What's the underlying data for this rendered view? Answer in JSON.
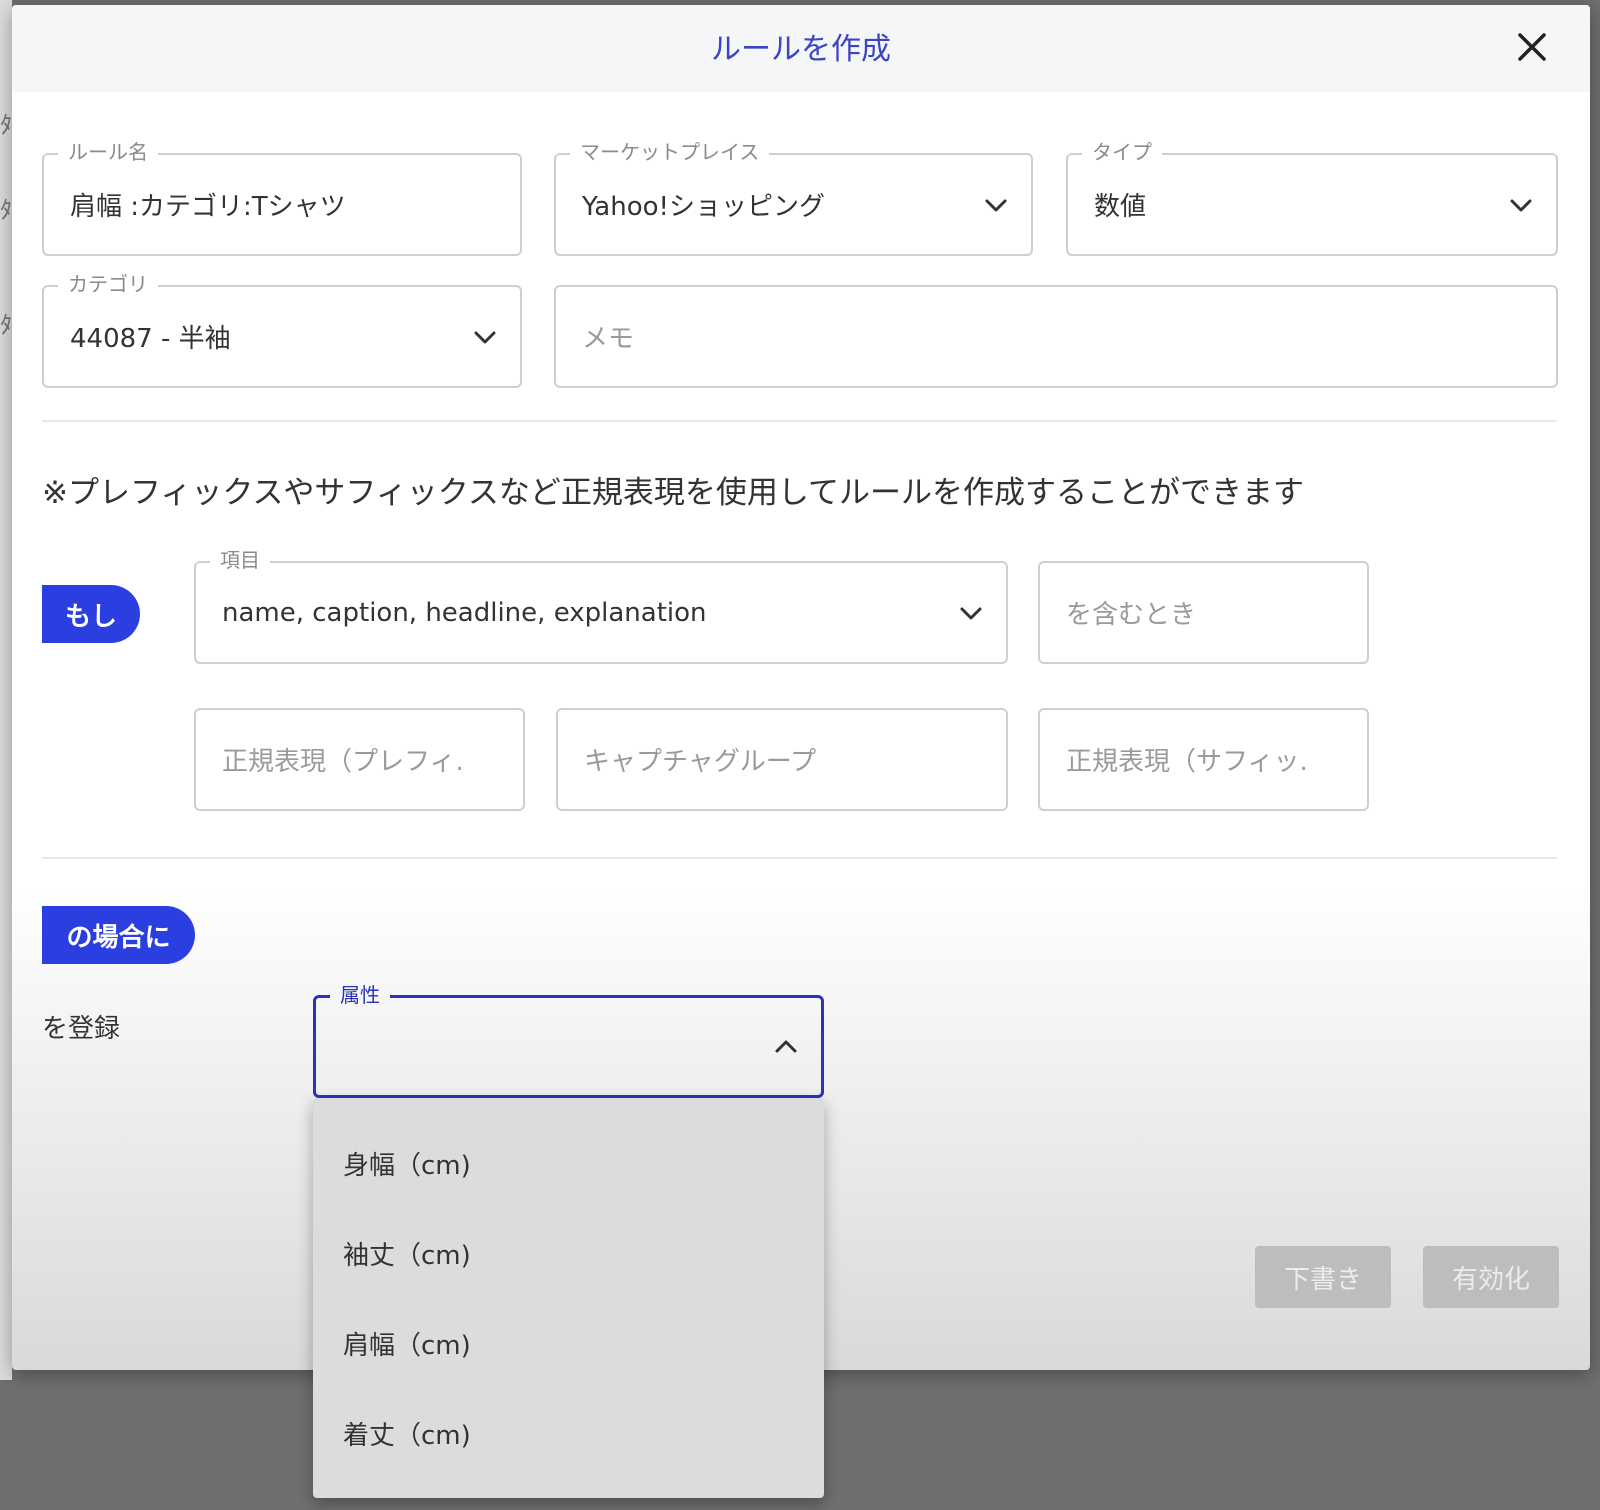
{
  "dialog": {
    "title": "ルールを作成"
  },
  "fields": {
    "rule_name": {
      "label": "ルール名",
      "value": "肩幅 :カテゴリ:Tシャツ"
    },
    "marketplace": {
      "label": "マーケットプレイス",
      "value": "Yahoo!ショッピング"
    },
    "type": {
      "label": "タイプ",
      "value": "数値"
    },
    "category": {
      "label": "カテゴリ",
      "value": "44087 - 半袖"
    },
    "memo": {
      "placeholder": "メモ"
    }
  },
  "note": "※プレフィックスやサフィックスなど正規表現を使用してルールを作成することができます",
  "condition": {
    "if_label": "もし",
    "item": {
      "label": "項目",
      "value": "name, caption, headline, explanation"
    },
    "contains": {
      "placeholder": "を含むとき"
    },
    "regex_prefix": {
      "placeholder": "正規表現（プレフィ..."
    },
    "capture_group": {
      "placeholder": "キャプチャグループ"
    },
    "regex_suffix": {
      "placeholder": "正規表現（サフィッ..."
    }
  },
  "action": {
    "case_label": "の場合に",
    "register_label": "を登録",
    "attribute": {
      "label": "属性",
      "value": "",
      "options": [
        "身幅（cm)",
        "袖丈（cm)",
        "肩幅（cm)",
        "着丈（cm)"
      ]
    }
  },
  "buttons": {
    "draft": "下書き",
    "enable": "有効化"
  },
  "colors": {
    "accent": "#2b3fe0",
    "title": "#3b45c4",
    "focus_border": "#2a34b8"
  },
  "icons": {
    "close": "close-icon",
    "chevron_down": "chevron-down-icon",
    "chevron_up": "chevron-up-icon"
  }
}
